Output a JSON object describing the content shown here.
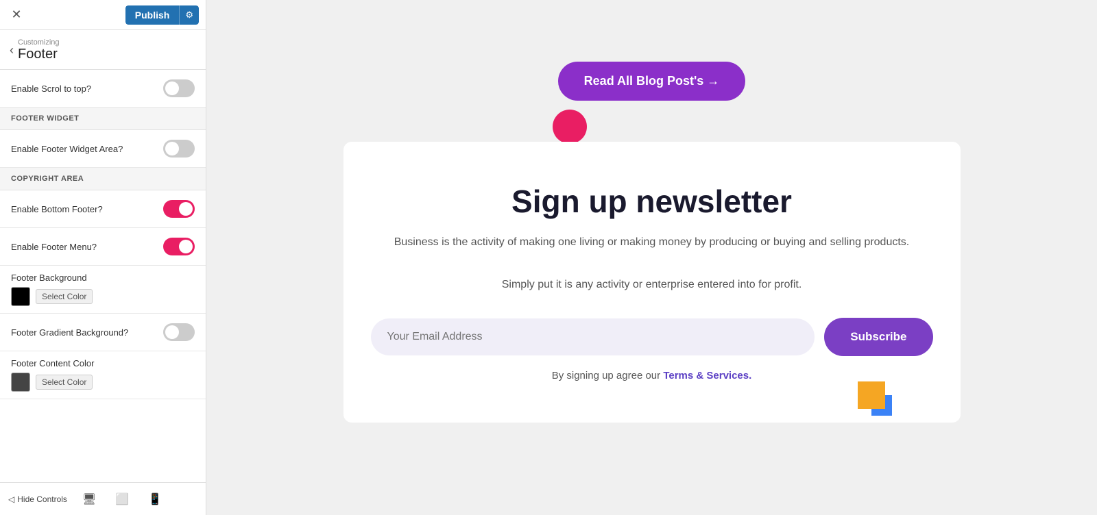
{
  "topBar": {
    "closeLabel": "✕",
    "publishLabel": "Publish",
    "gearLabel": "⚙"
  },
  "breadcrumb": {
    "backLabel": "‹",
    "subLabel": "Customizing",
    "titleLabel": "Footer"
  },
  "controls": {
    "scrollToTop": {
      "label": "Enable Scrol to top?",
      "checked": false
    },
    "footerWidget": {
      "sectionHeader": "FOOTER WIDGET",
      "enableLabel": "Enable Footer Widget Area?",
      "checked": false
    },
    "copyrightArea": {
      "sectionHeader": "COPYRIGHT AREA",
      "enableBottomLabel": "Enable Bottom Footer?",
      "enableBottomChecked": true,
      "enableMenuLabel": "Enable Footer Menu?",
      "enableMenuChecked": true,
      "bgLabel": "Footer Background",
      "bgColorHex": "#000000",
      "bgSelectLabel": "Select Color",
      "gradientLabel": "Footer Gradient Background?",
      "gradientChecked": false,
      "contentColorLabel": "Footer Content Color",
      "contentColorHex": "#333333",
      "contentSelectLabel": "Select Color"
    }
  },
  "bottomBar": {
    "hideControlsLabel": "Hide Controls",
    "desktopIcon": "🖥",
    "tabletIcon": "▭",
    "mobileIcon": "📱"
  },
  "preview": {
    "blogBtnLabel": "Read All Blog Post's →",
    "newsletterTitle": "Sign up newsletter",
    "newsletterDesc1": "Business is the activity of making one living or making money by producing or buying and selling products.",
    "newsletterDesc2": "Simply put it is any activity or enterprise entered into for profit.",
    "emailPlaceholder": "Your Email Address",
    "subscribeLabel": "Subscribe",
    "termsPrefix": "By signing up agree our ",
    "termsLink": "Terms & Services."
  }
}
